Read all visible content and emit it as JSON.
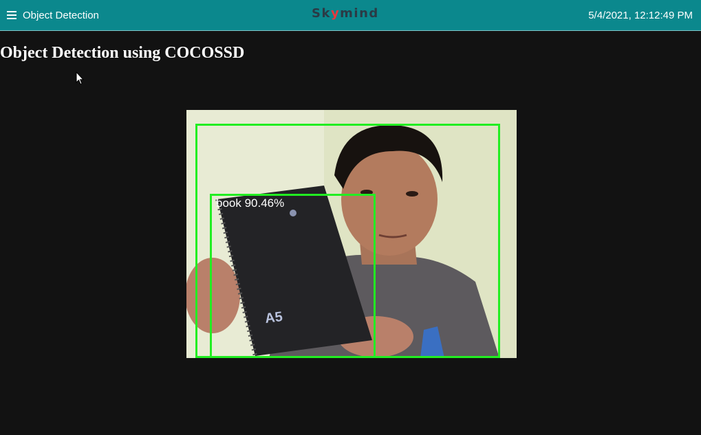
{
  "header": {
    "menu_icon": "hamburger-menu-icon",
    "title": "Object Detection",
    "brand_prefix": "Sk",
    "brand_y": "y",
    "brand_suffix": "mind",
    "datetime": "5/4/2021, 12:12:49 PM",
    "background_color": "#0b888d"
  },
  "main": {
    "heading": "Object Detection using COCOSSD",
    "video": {
      "detections": [
        {
          "class": "person",
          "label": ""
        },
        {
          "class": "book",
          "label": "book 90.46%"
        }
      ],
      "box_color": "#22ee22"
    }
  }
}
